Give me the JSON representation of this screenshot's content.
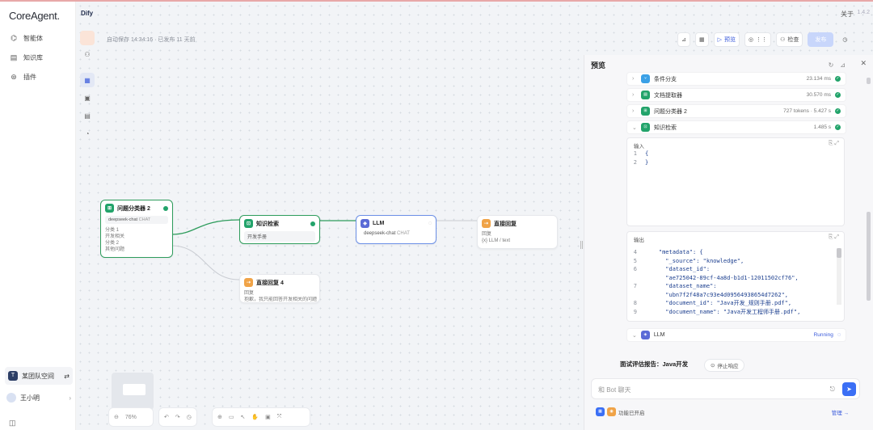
{
  "sidebar": {
    "brand": "CoreAgent.",
    "items": [
      {
        "icon": "agent-icon",
        "label": "智能体"
      },
      {
        "icon": "knowledge-icon",
        "label": "知识库"
      },
      {
        "icon": "plugin-icon",
        "label": "插件"
      }
    ],
    "workspace": {
      "logo": "T",
      "name": "某团队空间"
    },
    "user": {
      "name": "王小明"
    }
  },
  "header": {
    "app_name": "Dify",
    "save_info": "自动保存 14:34:16 · 已发布 11 天前",
    "top_right": "关于",
    "version": "1.4.2",
    "buttons": {
      "preview": "预览",
      "check": "检查",
      "publish": "发布"
    }
  },
  "canvas": {
    "zoom": "76%",
    "nodes": {
      "classifier": {
        "title": "问题分类器 2",
        "model": "deepseek-chat",
        "model_tag": "CHAT",
        "class1_label": "分类 1",
        "class1_value": "开发相关",
        "class2_label": "分类 2",
        "class2_value": "其他问题"
      },
      "retrieval": {
        "title": "知识检索",
        "sub": "开发手册"
      },
      "llm": {
        "title": "LLM",
        "model": "deepseek-chat",
        "tag": "CHAT"
      },
      "answer": {
        "title": "直接回复",
        "line1": "回复",
        "line2": "{x} LLM / text"
      },
      "answer2": {
        "title": "直接回复 4",
        "line1": "回复",
        "line2": "抱歉，我只能回答开发相关的问题"
      }
    }
  },
  "preview": {
    "title": "预览",
    "steps": [
      {
        "name": "条件分支",
        "meta": "23.134 ms",
        "icon": "branch-icon",
        "color": "#3aa0e6"
      },
      {
        "name": "文档提取器",
        "meta": "30.570 ms",
        "icon": "doc-extract-icon",
        "color": "#22a36a"
      },
      {
        "name": "问题分类器 2",
        "meta": "727 tokens · 5.427 s",
        "icon": "classifier-icon",
        "color": "#22a36a"
      },
      {
        "name": "知识检索",
        "meta": "1.485 s",
        "icon": "retrieval-icon",
        "color": "#22a36a"
      }
    ],
    "input_label": "输入",
    "input_lines": [
      {
        "n": "1",
        "t": "{"
      },
      {
        "n": "2",
        "t": "}"
      }
    ],
    "output_label": "输出",
    "output_lines": [
      {
        "n": "4",
        "t": "    \"metadata\": {"
      },
      {
        "n": "5",
        "t": "      \"_source\": \"knowledge\","
      },
      {
        "n": "6",
        "t": "      \"dataset_id\":"
      },
      {
        "n": "",
        "t": "      \"ae725042-89cf-4a8d-b1d1-12011502cf76\","
      },
      {
        "n": "7",
        "t": "      \"dataset_name\":"
      },
      {
        "n": "",
        "t": "      \"ubn7f2f48a7c93e4d09564938654d7262\","
      },
      {
        "n": "8",
        "t": "      \"document_id\": \"Java开发_规则手册.pdf\","
      },
      {
        "n": "9",
        "t": "      \"document_name\": \"Java开发工程师手册.pdf\","
      }
    ],
    "llm_step": {
      "name": "LLM",
      "status": "Running"
    },
    "answer_text": "面试评估报告：Java开发",
    "stop_label": "停止响应",
    "chat_placeholder": "和 Bot 聊天",
    "feature_label": "功能已开启",
    "feature_link": "管理"
  },
  "colors": {
    "accent": "#3b6ff5",
    "success": "#22a36a",
    "llm": "#5b6bd6",
    "answer": "#f0a347"
  }
}
